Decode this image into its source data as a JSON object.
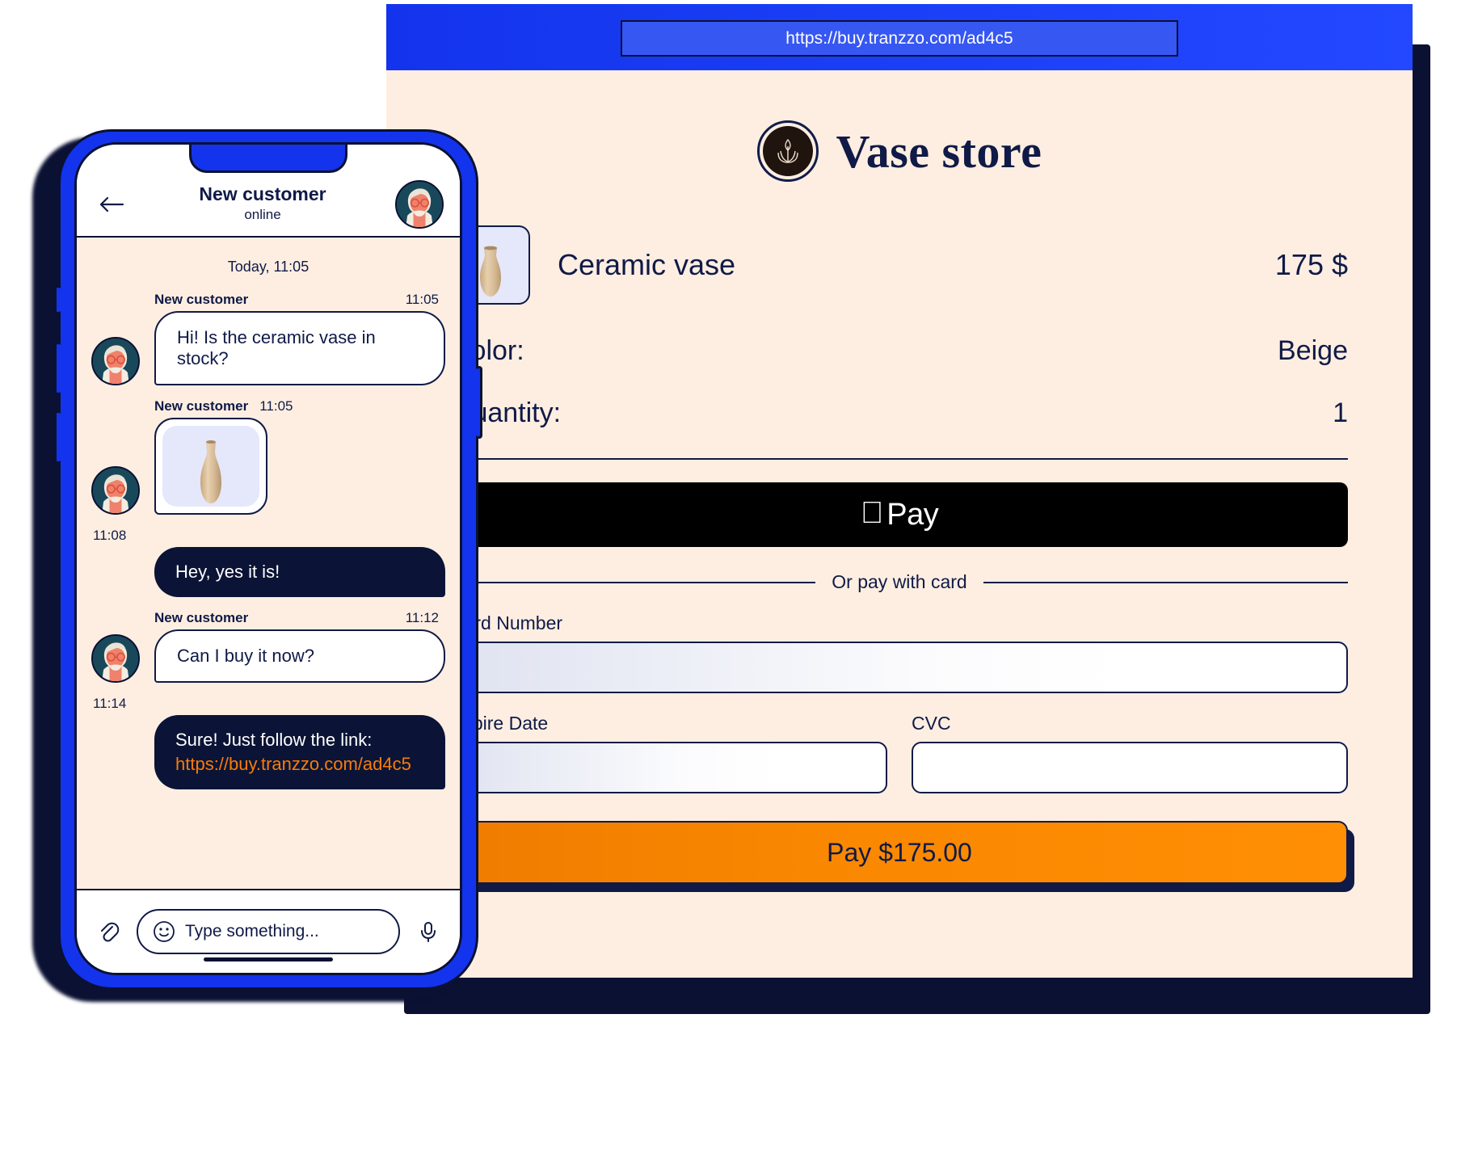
{
  "browser": {
    "url": "https://buy.tranzzo.com/ad4c5"
  },
  "store": {
    "name": "Vase store",
    "logo_icon": "plant-leaf-emblem-icon"
  },
  "checkout": {
    "product": {
      "thumb_icon": "ceramic-vase-thumbnail",
      "title": "Ceramic vase",
      "price": "175 $"
    },
    "attributes": [
      {
        "label": "Color:",
        "value": "Beige"
      },
      {
        "label": "Quantity:",
        "value": "1"
      }
    ],
    "apple_pay": {
      "logo": "",
      "label": "Pay"
    },
    "or_divider": "Or pay with card",
    "fields": {
      "card_number": {
        "label": "Card Number",
        "value": ""
      },
      "expire_date": {
        "label": "Expire Date",
        "value": ""
      },
      "cvc": {
        "label": "CVC",
        "value": ""
      }
    },
    "pay_button": "Pay $175.00"
  },
  "phone": {
    "header": {
      "back_icon": "back-arrow-icon",
      "title": "New customer",
      "status": "online",
      "avatar_icon": "customer-avatar-icon"
    },
    "chat": {
      "day_stamp": "Today, 11:05",
      "messages": [
        {
          "direction": "in",
          "who": "New customer",
          "time": "11:05",
          "type": "text",
          "text": "Hi! Is the ceramic vase in stock?"
        },
        {
          "direction": "in",
          "who": "New customer",
          "time": "11:05",
          "type": "image",
          "text": ""
        },
        {
          "direction": "out",
          "who": "",
          "time": "11:08",
          "type": "text",
          "text": "Hey, yes it is!"
        },
        {
          "direction": "in",
          "who": "New customer",
          "time": "11:12",
          "type": "text",
          "text": "Can I buy it now?"
        },
        {
          "direction": "out",
          "who": "",
          "time": "11:14",
          "type": "link",
          "text": "Sure! Just follow the link:",
          "link": "https://buy.tranzzo.com/ad4c5"
        }
      ]
    },
    "input_bar": {
      "attach_icon": "paperclip-icon",
      "emoji_icon": "smiley-icon",
      "placeholder": "Type something...",
      "mic_icon": "microphone-icon"
    }
  },
  "colors": {
    "brand_blue": "#1334ec",
    "cream": "#fdeee1",
    "navy": "#101a47",
    "orange": "#f97c07",
    "bubble_dark": "#0b1436"
  }
}
